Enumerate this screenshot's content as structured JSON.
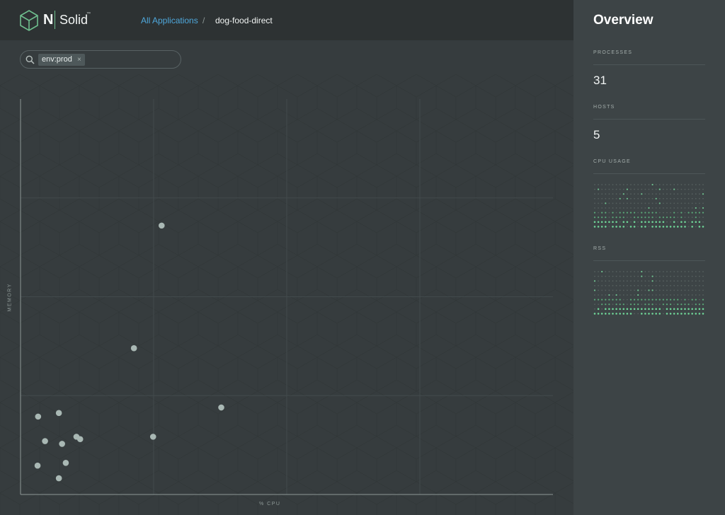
{
  "brand": {
    "letter": "N",
    "name": "Solid",
    "trademark": "™"
  },
  "breadcrumb": {
    "root_label": "All Applications",
    "separator": "/",
    "current": "dog-food-direct"
  },
  "filter": {
    "tag": "env:prod",
    "remove_glyph": "×"
  },
  "chart_data": {
    "type": "scatter",
    "xlabel": "% CPU",
    "ylabel": "MEMORY",
    "xlim": [
      0,
      100
    ],
    "ylim": [
      0,
      100
    ],
    "grid": true,
    "points": [
      {
        "x": 26.5,
        "y": 68.0
      },
      {
        "x": 21.3,
        "y": 37.0
      },
      {
        "x": 37.7,
        "y": 22.0
      },
      {
        "x": 24.9,
        "y": 14.6
      },
      {
        "x": 3.3,
        "y": 19.7
      },
      {
        "x": 7.2,
        "y": 20.6
      },
      {
        "x": 10.5,
        "y": 14.6
      },
      {
        "x": 11.2,
        "y": 14.0
      },
      {
        "x": 4.6,
        "y": 13.5
      },
      {
        "x": 7.8,
        "y": 12.8
      },
      {
        "x": 3.2,
        "y": 7.3
      },
      {
        "x": 8.5,
        "y": 8.0
      },
      {
        "x": 7.2,
        "y": 4.1
      }
    ]
  },
  "overview": {
    "title": "Overview",
    "processes_label": "PROCESSES",
    "processes_value": "31",
    "hosts_label": "HOSTS",
    "hosts_value": "5",
    "cpu_label": "CPU USAGE",
    "rss_label": "RSS"
  },
  "colors": {
    "accent_green": "#6fbf8e",
    "link_blue": "#4fa8dc",
    "point": "#a9b8b4"
  },
  "icons": {
    "logo": "nodesource-cube-logo",
    "search": "search-icon",
    "remove": "close-icon"
  }
}
